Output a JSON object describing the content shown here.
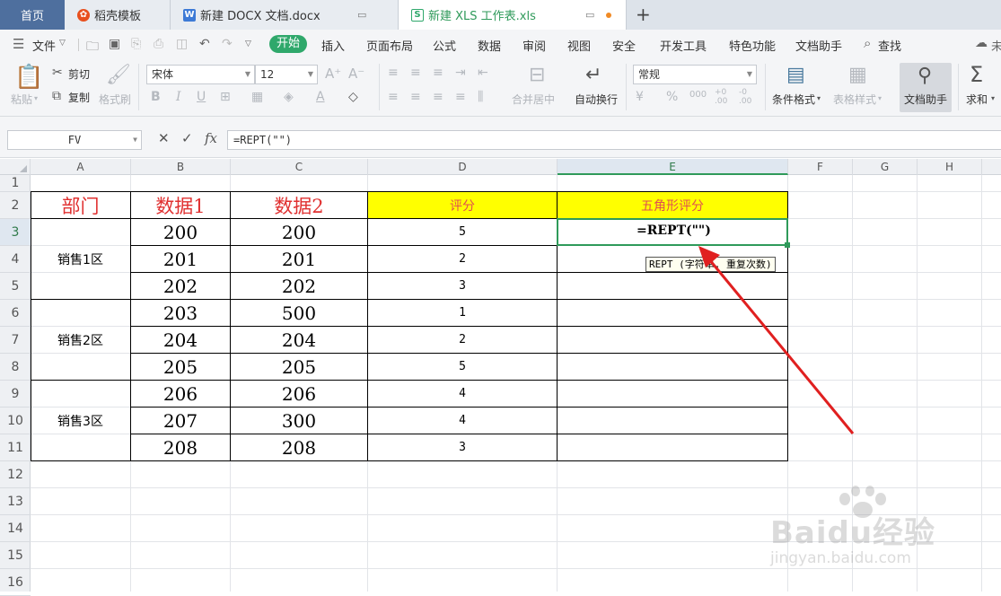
{
  "tabs": [
    {
      "label": "首页",
      "icon": "home"
    },
    {
      "label": "稻壳模板",
      "icon": "docer-logo-icon"
    },
    {
      "label": "新建 DOCX 文档.docx",
      "icon": "word-doc-icon"
    },
    {
      "label": "新建 XLS 工作表.xls",
      "icon": "spreadsheet-icon"
    }
  ],
  "new_tab_label": "+",
  "menu": {
    "file": "文件",
    "start": "开始",
    "items": [
      "插入",
      "页面布局",
      "公式",
      "数据",
      "审阅",
      "视图",
      "安全",
      "开发工具",
      "特色功能",
      "文档助手"
    ],
    "search": "查找",
    "cut_off": "未"
  },
  "ribbon": {
    "paste": "粘贴",
    "cut": "剪切",
    "copy": "复制",
    "format_painter": "格式刷",
    "font_name": "宋体",
    "font_size": "12",
    "merge_center": "合并居中",
    "wrap_text": "自动换行",
    "number_format": "常规",
    "conditional_format": "条件格式",
    "table_style": "表格样式",
    "doc_assistant": "文档助手",
    "sum": "求和"
  },
  "formula_bar": {
    "name_box": "FV",
    "formula": "=REPT(\"\")"
  },
  "columns": [
    "A",
    "B",
    "C",
    "D",
    "E",
    "F",
    "G",
    "H"
  ],
  "rows": [
    "1",
    "2",
    "3",
    "4",
    "5",
    "6",
    "7",
    "8",
    "9",
    "10",
    "11",
    "12",
    "13",
    "14",
    "15",
    "16"
  ],
  "table": {
    "headers": [
      "部门",
      "数据1",
      "数据2",
      "评分",
      "五角形评分"
    ],
    "departments": [
      "销售1区",
      "销售2区",
      "销售3区"
    ],
    "data1": [
      "200",
      "201",
      "202",
      "203",
      "204",
      "205",
      "206",
      "207",
      "208"
    ],
    "data2": [
      "200",
      "201",
      "202",
      "500",
      "204",
      "205",
      "206",
      "300",
      "208"
    ],
    "scores": [
      "5",
      "2",
      "3",
      "1",
      "2",
      "5",
      "4",
      "4",
      "3"
    ]
  },
  "active_cell_edit": "=REPT(\"\")",
  "tooltip": "REPT (字符串, 重复次数)",
  "colors": {
    "accent_green": "#2fa86b",
    "header_yellow": "#ffff00",
    "header_red": "#e03030",
    "arrow_red": "#e02020"
  },
  "watermark": {
    "text": "Baidu经验",
    "url": "jingyan.baidu.com"
  }
}
